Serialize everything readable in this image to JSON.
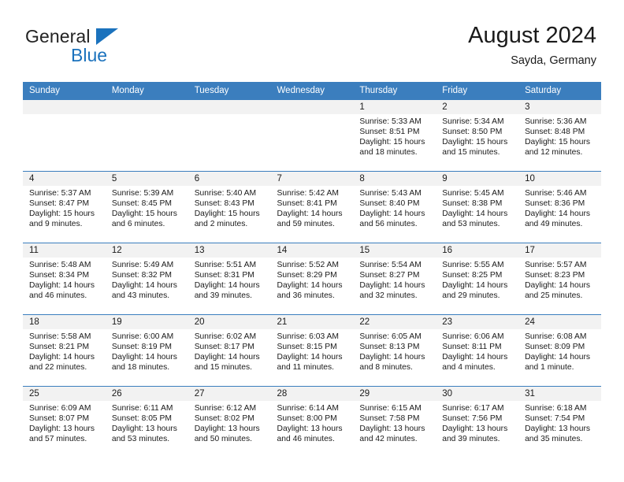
{
  "brand": {
    "name_part1": "General",
    "name_part2": "Blue",
    "flag_icon": "blue-triangle-flag-icon",
    "accent_color": "#1b72bd"
  },
  "header": {
    "title": "August 2024",
    "subtitle": "Sayda, Germany"
  },
  "theme": {
    "header_row_bg": "#3b7ebe",
    "day_band_bg": "#f2f2f2",
    "row_separator": "#3b7ebe",
    "text": "#1a1a1a"
  },
  "weekday_headers": [
    "Sunday",
    "Monday",
    "Tuesday",
    "Wednesday",
    "Thursday",
    "Friday",
    "Saturday"
  ],
  "labels": {
    "sunrise_prefix": "Sunrise:",
    "sunset_prefix": "Sunset:",
    "daylight_prefix": "Daylight:"
  },
  "weeks": [
    [
      {
        "day": "",
        "empty": true,
        "line1": "",
        "line2": "",
        "line3": "",
        "line4": ""
      },
      {
        "day": "",
        "empty": true,
        "line1": "",
        "line2": "",
        "line3": "",
        "line4": ""
      },
      {
        "day": "",
        "empty": true,
        "line1": "",
        "line2": "",
        "line3": "",
        "line4": ""
      },
      {
        "day": "",
        "empty": true,
        "line1": "",
        "line2": "",
        "line3": "",
        "line4": ""
      },
      {
        "day": "1",
        "empty": false,
        "line1": "Sunrise: 5:33 AM",
        "line2": "Sunset: 8:51 PM",
        "line3": "Daylight: 15 hours",
        "line4": "and 18 minutes."
      },
      {
        "day": "2",
        "empty": false,
        "line1": "Sunrise: 5:34 AM",
        "line2": "Sunset: 8:50 PM",
        "line3": "Daylight: 15 hours",
        "line4": "and 15 minutes."
      },
      {
        "day": "3",
        "empty": false,
        "line1": "Sunrise: 5:36 AM",
        "line2": "Sunset: 8:48 PM",
        "line3": "Daylight: 15 hours",
        "line4": "and 12 minutes."
      }
    ],
    [
      {
        "day": "4",
        "empty": false,
        "line1": "Sunrise: 5:37 AM",
        "line2": "Sunset: 8:47 PM",
        "line3": "Daylight: 15 hours",
        "line4": "and 9 minutes."
      },
      {
        "day": "5",
        "empty": false,
        "line1": "Sunrise: 5:39 AM",
        "line2": "Sunset: 8:45 PM",
        "line3": "Daylight: 15 hours",
        "line4": "and 6 minutes."
      },
      {
        "day": "6",
        "empty": false,
        "line1": "Sunrise: 5:40 AM",
        "line2": "Sunset: 8:43 PM",
        "line3": "Daylight: 15 hours",
        "line4": "and 2 minutes."
      },
      {
        "day": "7",
        "empty": false,
        "line1": "Sunrise: 5:42 AM",
        "line2": "Sunset: 8:41 PM",
        "line3": "Daylight: 14 hours",
        "line4": "and 59 minutes."
      },
      {
        "day": "8",
        "empty": false,
        "line1": "Sunrise: 5:43 AM",
        "line2": "Sunset: 8:40 PM",
        "line3": "Daylight: 14 hours",
        "line4": "and 56 minutes."
      },
      {
        "day": "9",
        "empty": false,
        "line1": "Sunrise: 5:45 AM",
        "line2": "Sunset: 8:38 PM",
        "line3": "Daylight: 14 hours",
        "line4": "and 53 minutes."
      },
      {
        "day": "10",
        "empty": false,
        "line1": "Sunrise: 5:46 AM",
        "line2": "Sunset: 8:36 PM",
        "line3": "Daylight: 14 hours",
        "line4": "and 49 minutes."
      }
    ],
    [
      {
        "day": "11",
        "empty": false,
        "line1": "Sunrise: 5:48 AM",
        "line2": "Sunset: 8:34 PM",
        "line3": "Daylight: 14 hours",
        "line4": "and 46 minutes."
      },
      {
        "day": "12",
        "empty": false,
        "line1": "Sunrise: 5:49 AM",
        "line2": "Sunset: 8:32 PM",
        "line3": "Daylight: 14 hours",
        "line4": "and 43 minutes."
      },
      {
        "day": "13",
        "empty": false,
        "line1": "Sunrise: 5:51 AM",
        "line2": "Sunset: 8:31 PM",
        "line3": "Daylight: 14 hours",
        "line4": "and 39 minutes."
      },
      {
        "day": "14",
        "empty": false,
        "line1": "Sunrise: 5:52 AM",
        "line2": "Sunset: 8:29 PM",
        "line3": "Daylight: 14 hours",
        "line4": "and 36 minutes."
      },
      {
        "day": "15",
        "empty": false,
        "line1": "Sunrise: 5:54 AM",
        "line2": "Sunset: 8:27 PM",
        "line3": "Daylight: 14 hours",
        "line4": "and 32 minutes."
      },
      {
        "day": "16",
        "empty": false,
        "line1": "Sunrise: 5:55 AM",
        "line2": "Sunset: 8:25 PM",
        "line3": "Daylight: 14 hours",
        "line4": "and 29 minutes."
      },
      {
        "day": "17",
        "empty": false,
        "line1": "Sunrise: 5:57 AM",
        "line2": "Sunset: 8:23 PM",
        "line3": "Daylight: 14 hours",
        "line4": "and 25 minutes."
      }
    ],
    [
      {
        "day": "18",
        "empty": false,
        "line1": "Sunrise: 5:58 AM",
        "line2": "Sunset: 8:21 PM",
        "line3": "Daylight: 14 hours",
        "line4": "and 22 minutes."
      },
      {
        "day": "19",
        "empty": false,
        "line1": "Sunrise: 6:00 AM",
        "line2": "Sunset: 8:19 PM",
        "line3": "Daylight: 14 hours",
        "line4": "and 18 minutes."
      },
      {
        "day": "20",
        "empty": false,
        "line1": "Sunrise: 6:02 AM",
        "line2": "Sunset: 8:17 PM",
        "line3": "Daylight: 14 hours",
        "line4": "and 15 minutes."
      },
      {
        "day": "21",
        "empty": false,
        "line1": "Sunrise: 6:03 AM",
        "line2": "Sunset: 8:15 PM",
        "line3": "Daylight: 14 hours",
        "line4": "and 11 minutes."
      },
      {
        "day": "22",
        "empty": false,
        "line1": "Sunrise: 6:05 AM",
        "line2": "Sunset: 8:13 PM",
        "line3": "Daylight: 14 hours",
        "line4": "and 8 minutes."
      },
      {
        "day": "23",
        "empty": false,
        "line1": "Sunrise: 6:06 AM",
        "line2": "Sunset: 8:11 PM",
        "line3": "Daylight: 14 hours",
        "line4": "and 4 minutes."
      },
      {
        "day": "24",
        "empty": false,
        "line1": "Sunrise: 6:08 AM",
        "line2": "Sunset: 8:09 PM",
        "line3": "Daylight: 14 hours",
        "line4": "and 1 minute."
      }
    ],
    [
      {
        "day": "25",
        "empty": false,
        "line1": "Sunrise: 6:09 AM",
        "line2": "Sunset: 8:07 PM",
        "line3": "Daylight: 13 hours",
        "line4": "and 57 minutes."
      },
      {
        "day": "26",
        "empty": false,
        "line1": "Sunrise: 6:11 AM",
        "line2": "Sunset: 8:05 PM",
        "line3": "Daylight: 13 hours",
        "line4": "and 53 minutes."
      },
      {
        "day": "27",
        "empty": false,
        "line1": "Sunrise: 6:12 AM",
        "line2": "Sunset: 8:02 PM",
        "line3": "Daylight: 13 hours",
        "line4": "and 50 minutes."
      },
      {
        "day": "28",
        "empty": false,
        "line1": "Sunrise: 6:14 AM",
        "line2": "Sunset: 8:00 PM",
        "line3": "Daylight: 13 hours",
        "line4": "and 46 minutes."
      },
      {
        "day": "29",
        "empty": false,
        "line1": "Sunrise: 6:15 AM",
        "line2": "Sunset: 7:58 PM",
        "line3": "Daylight: 13 hours",
        "line4": "and 42 minutes."
      },
      {
        "day": "30",
        "empty": false,
        "line1": "Sunrise: 6:17 AM",
        "line2": "Sunset: 7:56 PM",
        "line3": "Daylight: 13 hours",
        "line4": "and 39 minutes."
      },
      {
        "day": "31",
        "empty": false,
        "line1": "Sunrise: 6:18 AM",
        "line2": "Sunset: 7:54 PM",
        "line3": "Daylight: 13 hours",
        "line4": "and 35 minutes."
      }
    ]
  ]
}
